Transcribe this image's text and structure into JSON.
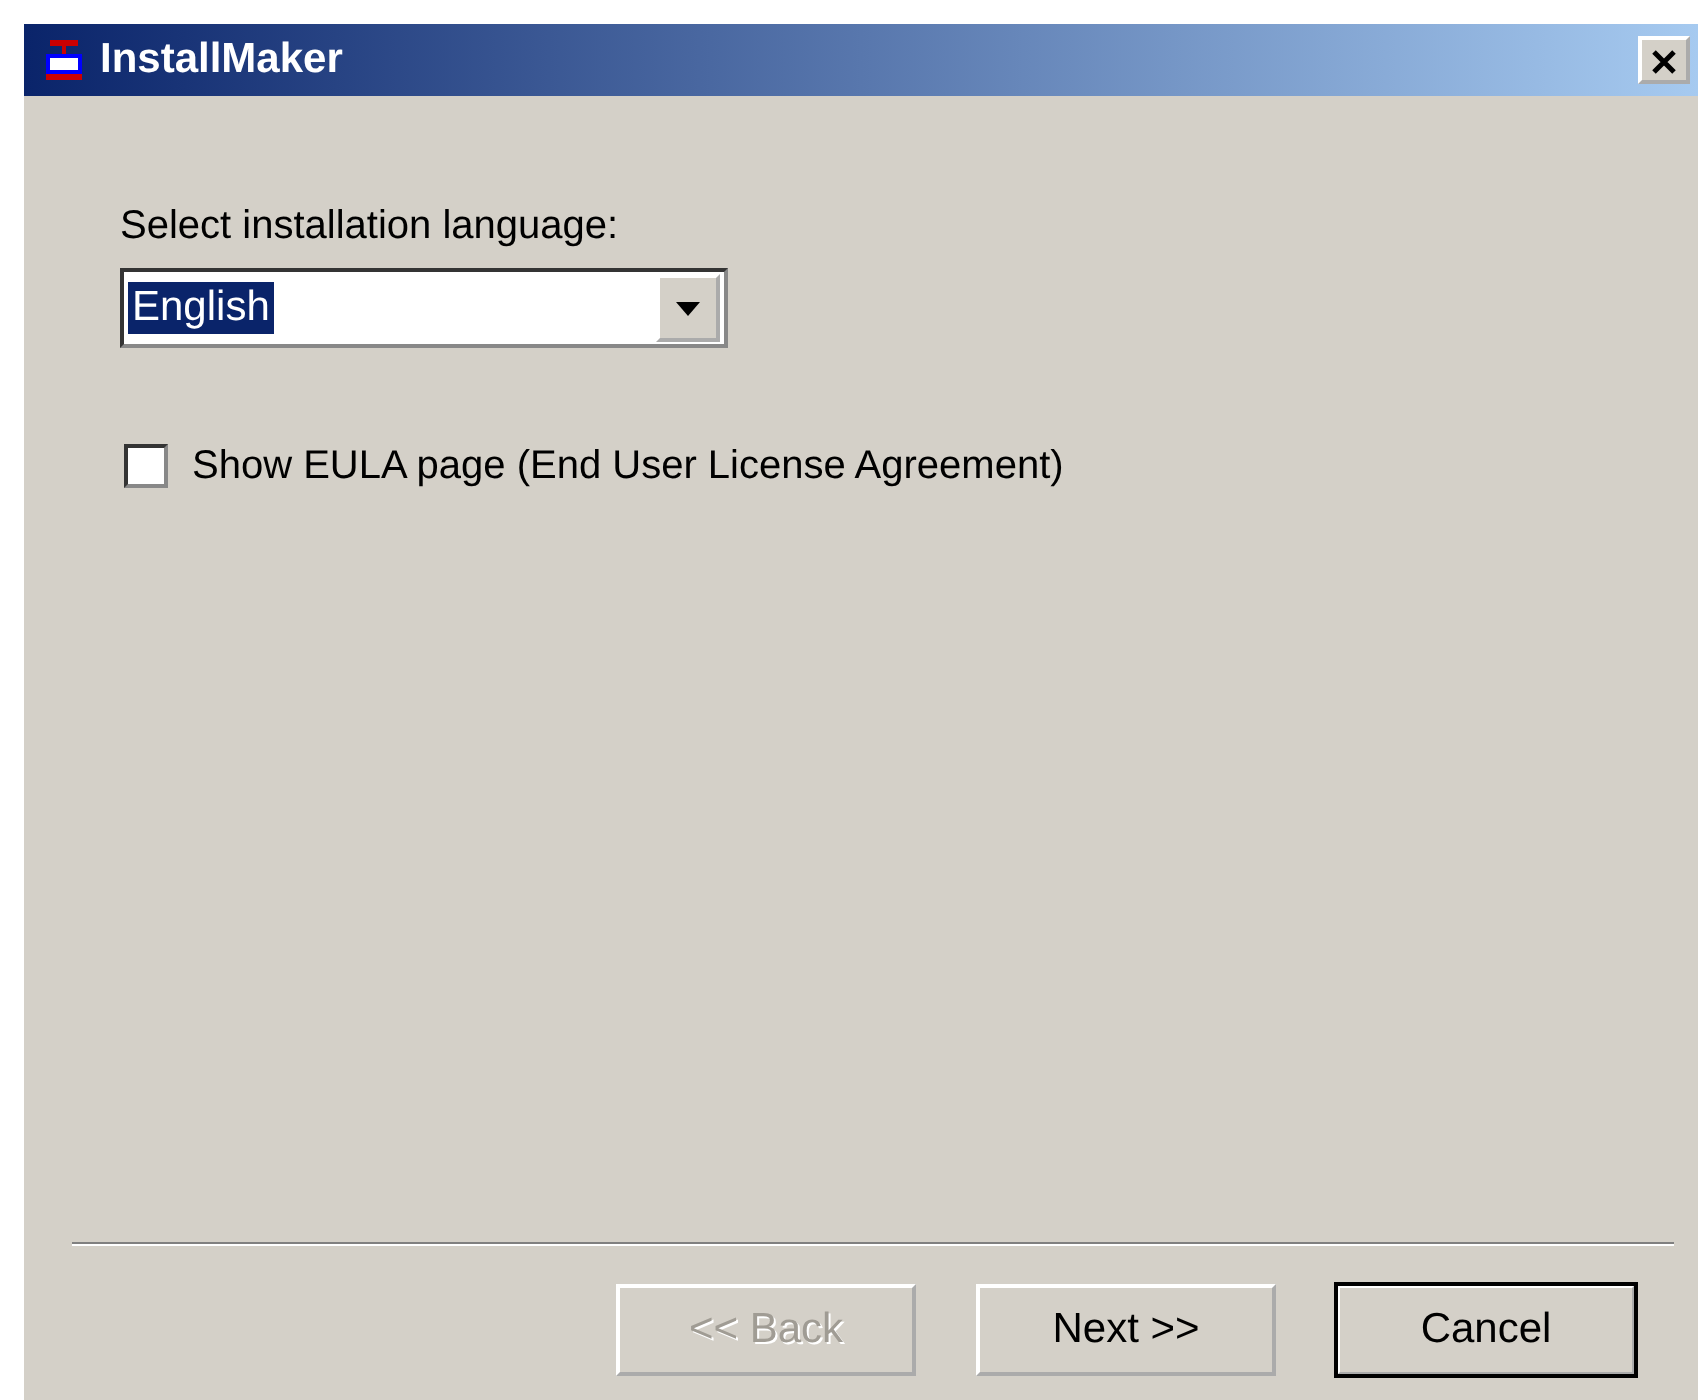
{
  "window": {
    "title": "InstallMaker"
  },
  "language": {
    "label": "Select installation language:",
    "value": "English",
    "highlighted": true
  },
  "eula": {
    "label": "Show EULA page (End User License Agreement)",
    "checked": false
  },
  "buttons": [
    {
      "label": "<< Back",
      "disabled": true,
      "default": false
    },
    {
      "label": "Next >>",
      "disabled": false,
      "default": false
    },
    {
      "label": "Cancel",
      "disabled": false,
      "default": true
    }
  ]
}
